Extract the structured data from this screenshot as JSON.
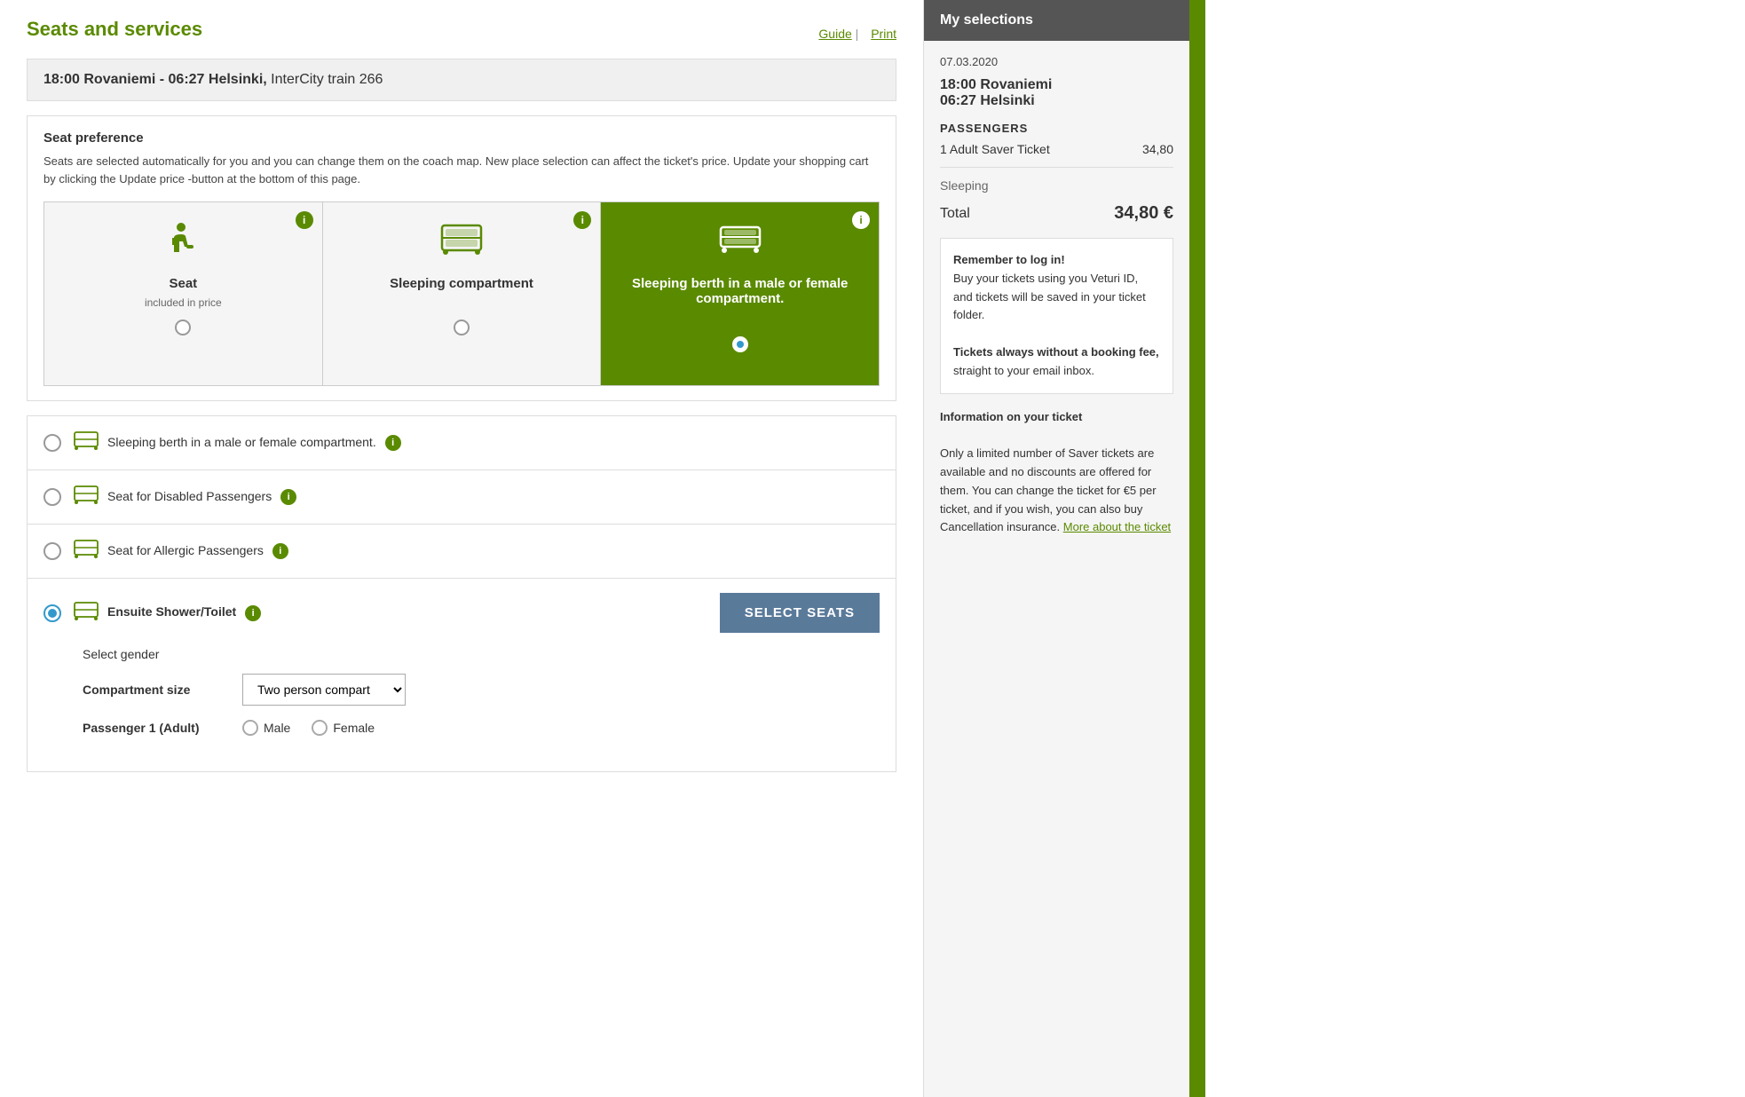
{
  "page": {
    "title": "Seats and services",
    "guide_link": "Guide",
    "print_link": "Print"
  },
  "train": {
    "departure_time": "18:00",
    "departure_station": "Rovaniemi",
    "separator": "-",
    "arrival_time": "06:27",
    "arrival_station": "Helsinki,",
    "train_name": "InterCity train 266"
  },
  "seat_preference": {
    "title": "Seat preference",
    "description": "Seats are selected automatically for you and you can change them on the coach map. New place selection can affect the ticket's price. Update your shopping cart by clicking the Update price -button at the bottom of this page."
  },
  "option_cards": [
    {
      "id": "seat",
      "label": "Seat",
      "sublabel": "included in price",
      "selected": false
    },
    {
      "id": "sleeping_compartment",
      "label": "Sleeping compartment",
      "sublabel": "",
      "selected": false
    },
    {
      "id": "sleeping_berth",
      "label": "Sleeping berth in a male or female compartment.",
      "sublabel": "",
      "selected": true
    }
  ],
  "service_items": [
    {
      "id": "sleeping_berth_list",
      "label": "Sleeping berth in a male or female compartment.",
      "checked": false,
      "has_info": true
    },
    {
      "id": "disabled",
      "label": "Seat for Disabled Passengers",
      "checked": false,
      "has_info": true
    },
    {
      "id": "allergic",
      "label": "Seat for Allergic Passengers",
      "checked": false,
      "has_info": true
    },
    {
      "id": "ensuite",
      "label": "Ensuite Shower/Toilet",
      "checked": true,
      "has_info": true,
      "expanded": true
    }
  ],
  "select_seats_btn": "SELECT SEATS",
  "select_gender_label": "Select gender",
  "compartment_size_label": "Compartment size",
  "compartment_size_value": "Two person compart ⇕",
  "passenger_label": "Passenger 1  (Adult)",
  "gender_options": [
    "Male",
    "Female"
  ],
  "sidebar": {
    "header": "My selections",
    "date": "07.03.2020",
    "route_line1": "18:00 Rovaniemi",
    "route_line2": "06:27 Helsinki",
    "passengers_title": "PASSENGERS",
    "passenger_row": "1 Adult Saver Ticket",
    "passenger_price": "34,80",
    "sleeping_label": "Sleeping",
    "total_label": "Total",
    "total_value": "34,80 €",
    "promo1_bold": "Remember to log in!",
    "promo1_text": "Buy your tickets using you Veturi ID, and tickets will be saved in your ticket folder.",
    "promo2_bold": "Tickets always without a booking fee,",
    "promo2_text": "straight to your email inbox.",
    "info_title": "Information on your ticket",
    "info_text": "Only a limited number of Saver tickets are available and no discounts are offered for them. You can change the ticket for €5 per ticket, and if you wish, you can also buy Cancellation insurance.",
    "info_link": "More about the ticket"
  }
}
